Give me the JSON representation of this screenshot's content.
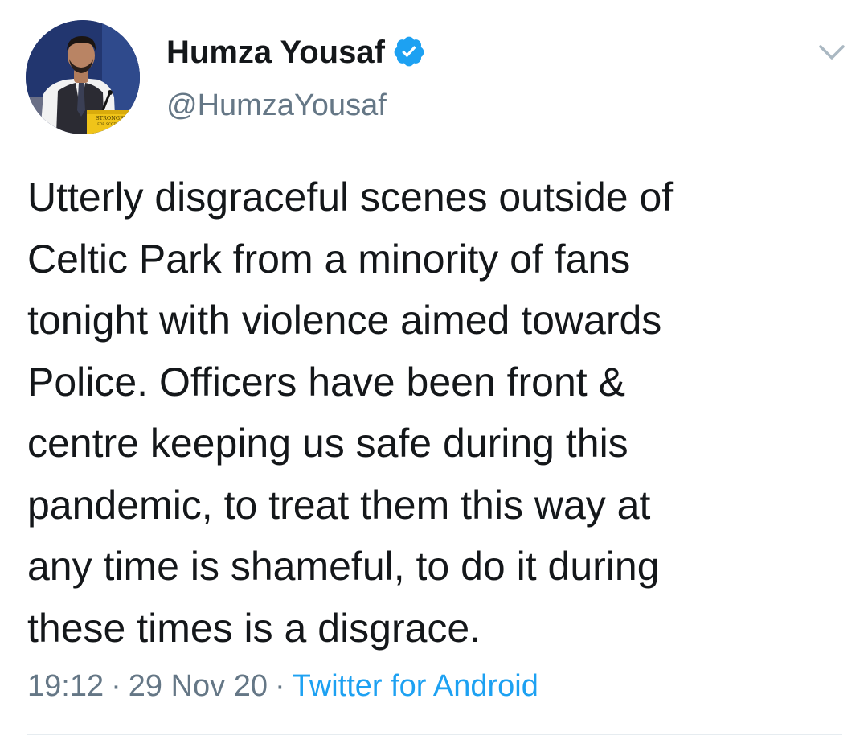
{
  "author": {
    "display_name": "Humza Yousaf",
    "handle": "@HumzaYousaf",
    "verified": true,
    "avatar_sign_text": "STRONGER FOR SCOTLAND"
  },
  "tweet": {
    "lines": [
      "Utterly disgraceful scenes outside of",
      "Celtic Park from a minority of fans",
      "tonight with violence aimed towards",
      "Police. Officers have been front &",
      "centre keeping us safe during this",
      "pandemic, to treat them this way at",
      "any time is shameful, to do it during",
      "these times is a disgrace."
    ],
    "time": "19:12",
    "date": "29 Nov 20",
    "source": "Twitter for Android",
    "separator": "·"
  },
  "icons": {
    "verified": "verified-badge-icon",
    "menu": "chevron-down-icon"
  },
  "colors": {
    "text": "#14171a",
    "secondary": "#657786",
    "link": "#1da1f2",
    "divider": "#e6ecf0"
  }
}
